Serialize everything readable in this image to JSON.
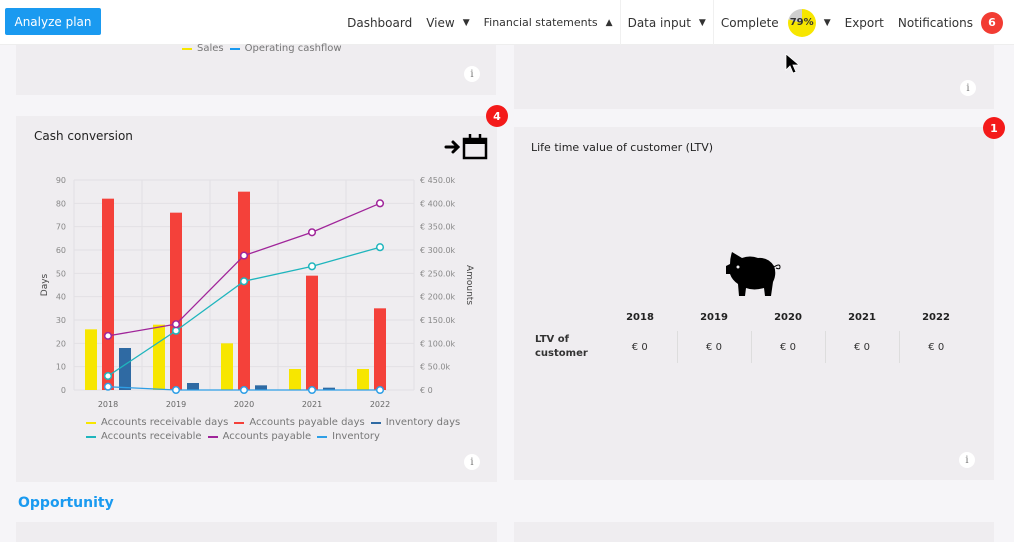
{
  "topbar": {
    "analyze_button": "Analyze plan",
    "nav": {
      "dashboard": "Dashboard",
      "view": "View",
      "financial_statements": "Financial statements",
      "data_input": "Data input",
      "complete": "Complete",
      "complete_percent_label": "79%",
      "complete_percent": 79,
      "export": "Export",
      "notifications": "Notifications",
      "notifications_count": "6"
    }
  },
  "top_left_card": {
    "legend": [
      {
        "label": "Sales",
        "color": "#f7e600"
      },
      {
        "label": "Operating cashflow",
        "color": "#1a9af0"
      }
    ],
    "info": "i"
  },
  "top_right_card": {
    "info": "i"
  },
  "cash_conversion": {
    "title": "Cash conversion",
    "badge": "4",
    "info": "i",
    "legend": [
      {
        "label": "Accounts receivable days",
        "color": "#f7e600"
      },
      {
        "label": "Accounts payable days",
        "color": "#f4413a"
      },
      {
        "label": "Inventory days",
        "color": "#2f6aa3"
      },
      {
        "label": "Accounts receivable",
        "color": "#1fb5bd"
      },
      {
        "label": "Accounts payable",
        "color": "#a0259a"
      },
      {
        "label": "Inventory",
        "color": "#2f9fe6"
      }
    ]
  },
  "chart_data": {
    "type": "bar",
    "title": "Cash conversion",
    "categories": [
      "2018",
      "2019",
      "2020",
      "2021",
      "2022"
    ],
    "xlabel": "",
    "ylabel": "Days",
    "ylabel_right": "Amounts",
    "ylim": [
      0,
      90
    ],
    "yticks": [
      "0",
      "10",
      "20",
      "30",
      "40",
      "50",
      "60",
      "70",
      "80",
      "90"
    ],
    "ylim_right": [
      0,
      450000
    ],
    "yticks_right": [
      "€  0",
      "€  50.0k",
      "€  100.0k",
      "€  150.0k",
      "€  200.0k",
      "€  250.0k",
      "€  300.0k",
      "€  350.0k",
      "€  400.0k",
      "€  450.0k"
    ],
    "grid": true,
    "legend_position": "bottom",
    "series": [
      {
        "name": "Accounts receivable days",
        "kind": "bar",
        "axis": "left",
        "color": "#f7e600",
        "values": [
          26,
          28,
          20,
          9,
          9
        ]
      },
      {
        "name": "Accounts payable days",
        "kind": "bar",
        "axis": "left",
        "color": "#f4413a",
        "values": [
          82,
          76,
          85,
          49,
          35
        ]
      },
      {
        "name": "Inventory days",
        "kind": "bar",
        "axis": "left",
        "color": "#2f6aa3",
        "values": [
          18,
          3,
          2,
          1,
          0
        ]
      },
      {
        "name": "Accounts receivable",
        "kind": "line",
        "axis": "right",
        "color": "#1fb5bd",
        "values": [
          30000,
          127000,
          233000,
          265000,
          306000
        ]
      },
      {
        "name": "Accounts payable",
        "kind": "line",
        "axis": "right",
        "color": "#a0259a",
        "values": [
          116000,
          141000,
          288000,
          338000,
          400000
        ]
      },
      {
        "name": "Inventory",
        "kind": "line",
        "axis": "right",
        "color": "#2f9fe6",
        "values": [
          7000,
          0,
          0,
          0,
          0
        ]
      }
    ]
  },
  "ltv": {
    "title": "Life time value of customer (LTV)",
    "badge": "1",
    "info": "i",
    "columns": [
      "2018",
      "2019",
      "2020",
      "2021",
      "2022"
    ],
    "row_label": "LTV of customer",
    "values": [
      "€ 0",
      "€ 0",
      "€ 0",
      "€ 0",
      "€ 0"
    ]
  },
  "sections": {
    "opportunity": "Opportunity"
  }
}
